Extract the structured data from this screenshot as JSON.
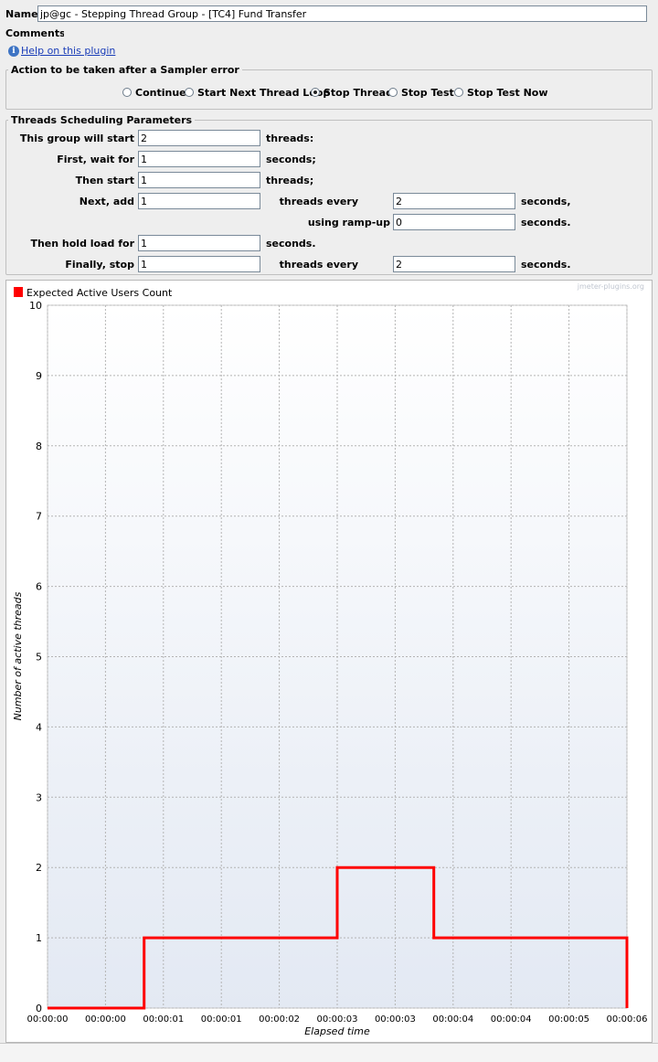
{
  "header": {
    "name_label": "Name:",
    "name_value": "jp@gc - Stepping Thread Group - [TC4] Fund Transfer",
    "comments_label": "Comments:",
    "help_link": "Help on this plugin",
    "help_icon": "info-icon"
  },
  "sampler_error": {
    "title": "Action to be taken after a Sampler error",
    "options": [
      "Continue",
      "Start Next Thread Loop",
      "Stop Thread",
      "Stop Test",
      "Stop Test Now"
    ],
    "selected": "Stop Thread"
  },
  "scheduling": {
    "title": "Threads Scheduling Parameters",
    "start_label": "This group will start",
    "start_value": "2",
    "start_unit": "threads:",
    "wait_label": "First, wait for",
    "wait_value": "1",
    "wait_unit": "seconds;",
    "then_label": "Then start",
    "then_value": "1",
    "then_unit": "threads;",
    "next_label": "Next, add",
    "next_value": "1",
    "next_every_label": "threads every",
    "next_every_value": "2",
    "next_every_unit": "seconds,",
    "ramp_label": "using ramp-up",
    "ramp_value": "0",
    "ramp_unit": "seconds.",
    "hold_label": "Then hold load for",
    "hold_value": "1",
    "hold_unit": "seconds.",
    "stop_label": "Finally, stop",
    "stop_value": "1",
    "stop_every_label": "threads every",
    "stop_every_value": "2",
    "stop_every_unit": "seconds."
  },
  "chart_data": {
    "type": "line",
    "legend": "Expected Active Users Count",
    "watermark": "jmeter-plugins.org",
    "xlabel": "Elapsed time",
    "ylabel": "Number of active threads",
    "ylim": [
      0,
      10
    ],
    "yticks": [
      "0",
      "1",
      "2",
      "3",
      "4",
      "5",
      "6",
      "7",
      "8",
      "9",
      "10"
    ],
    "xlim_seconds": [
      0,
      6
    ],
    "xticks": [
      "00:00:00",
      "00:00:00",
      "00:00:01",
      "00:00:01",
      "00:00:02",
      "00:00:03",
      "00:00:03",
      "00:00:04",
      "00:00:04",
      "00:00:05",
      "00:00:06"
    ],
    "series": [
      {
        "name": "Expected Active Users Count",
        "color": "#ff0000",
        "points": [
          [
            0,
            0
          ],
          [
            1,
            0
          ],
          [
            1,
            1
          ],
          [
            3,
            1
          ],
          [
            3,
            2
          ],
          [
            4,
            2
          ],
          [
            4,
            1
          ],
          [
            6,
            1
          ],
          [
            6,
            0
          ]
        ]
      }
    ],
    "grid": true,
    "legend_position": "top-left"
  }
}
